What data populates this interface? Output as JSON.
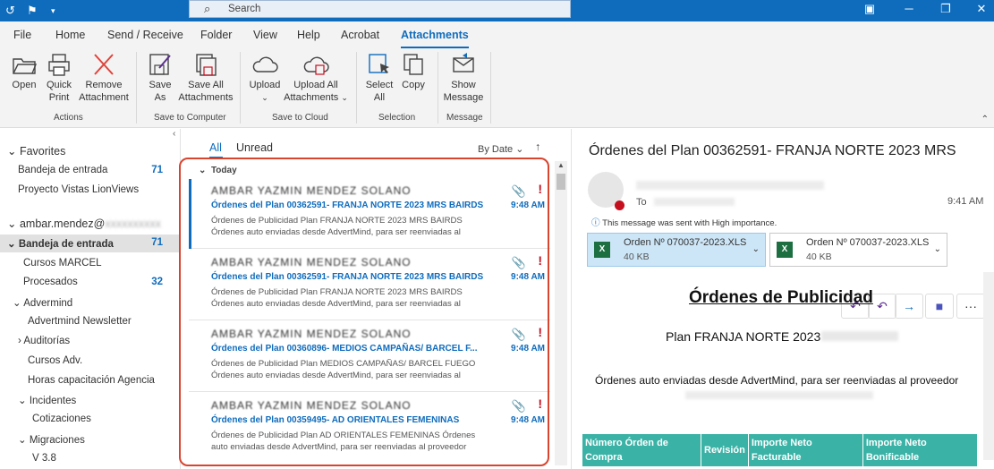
{
  "search": {
    "placeholder": "Search"
  },
  "menu": [
    "File",
    "Home",
    "Send / Receive",
    "Folder",
    "View",
    "Help",
    "Acrobat",
    "Attachments"
  ],
  "ribbon": {
    "open": "Open",
    "quick_print": "Quick",
    "quick_print2": "Print",
    "remove": "Remove",
    "remove2": "Attachment",
    "save_as": "Save",
    "save_as2": "As",
    "save_all": "Save All",
    "save_all2": "Attachments",
    "upload": "Upload",
    "upload_all": "Upload All",
    "upload_all2": "Attachments",
    "select_all": "Select",
    "select_all2": "All",
    "copy": "Copy",
    "show_msg": "Show",
    "show_msg2": "Message",
    "groups": {
      "actions": "Actions",
      "save_computer": "Save to Computer",
      "save_cloud": "Save to Cloud",
      "selection": "Selection",
      "message": "Message"
    }
  },
  "nav": {
    "favorites": "Favorites",
    "inbox": "Bandeja de entrada",
    "inbox_count": "71",
    "proyecto": "Proyecto Vistas LionViews",
    "account": "ambar.mendez@",
    "inbox2": "Bandeja de entrada",
    "inbox2_count": "71",
    "cursos_marcel": "Cursos MARCEL",
    "procesados": "Procesados",
    "procesados_count": "32",
    "advermind": "Advermind",
    "newsletter": "Advertmind Newsletter",
    "auditorias": "Auditorías",
    "cursos_adv": "Cursos Adv.",
    "horas": "Horas capacitación Agencia",
    "incidentes": "Incidentes",
    "cotizaciones": "Cotizaciones",
    "migraciones": "Migraciones",
    "v38": "V 3.8"
  },
  "list": {
    "all": "All",
    "unread": "Unread",
    "sort": "By Date",
    "group": "Today",
    "items": [
      {
        "from": "AMBAR YAZMIN MENDEZ SOLANO",
        "subject": "Órdenes del Plan 00362591- FRANJA NORTE 2023 MRS BAIRDS",
        "preview": "Órdenes de Publicidad  Plan FRANJA NORTE 2023 MRS BAIRDS Órdenes auto enviadas desde AdvertMind, para ser reenviadas al",
        "time": "9:48 AM"
      },
      {
        "from": "AMBAR YAZMIN MENDEZ SOLANO",
        "subject": "Órdenes del Plan 00362591- FRANJA NORTE 2023 MRS BAIRDS",
        "preview": "Órdenes de Publicidad  Plan FRANJA NORTE 2023 MRS BAIRDS Órdenes auto enviadas desde AdvertMind, para ser reenviadas al",
        "time": "9:48 AM"
      },
      {
        "from": "AMBAR YAZMIN MENDEZ SOLANO",
        "subject": "Órdenes del Plan 00360896- MEDIOS CAMPAÑAS/ BARCEL F...",
        "preview": "Órdenes de Publicidad  Plan MEDIOS CAMPAÑAS/ BARCEL FUEGO Órdenes auto enviadas desde AdvertMind, para ser reenviadas al",
        "time": "9:48 AM"
      },
      {
        "from": "AMBAR YAZMIN MENDEZ SOLANO",
        "subject": "Órdenes del Plan 00359495- AD ORIENTALES  FEMENINAS",
        "preview": "Órdenes de Publicidad  Plan AD ORIENTALES FEMENINAS  Órdenes auto enviadas desde AdvertMind, para ser reenviadas al proveedor",
        "time": "9:48 AM"
      }
    ]
  },
  "reading": {
    "subject": "Órdenes del Plan 00362591- FRANJA NORTE 2023 MRS",
    "to": "To",
    "time": "9:41 AM",
    "importance": "This message was sent with High importance.",
    "attachments": [
      {
        "name": "Orden Nº 070037-2023.XLS",
        "size": "40 KB"
      },
      {
        "name": "Orden Nº 070037-2023.XLS",
        "size": "40 KB"
      }
    ],
    "heading": "Órdenes de Publicidad",
    "plan": "Plan FRANJA NORTE 2023",
    "body": "Órdenes auto enviadas desde AdvertMind, para ser reenviadas al proveedor",
    "table": [
      "Número Órden de Compra",
      "Revisión",
      "Importe Neto Facturable",
      "Importe Neto Bonificable"
    ]
  }
}
